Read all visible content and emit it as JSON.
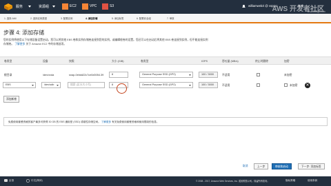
{
  "nav": {
    "services": "服务",
    "resource_groups": "资源组",
    "ec2": "EC2",
    "vpc": "VPC",
    "s3": "S3",
    "account": "williamwebzi @ vopmo",
    "region": "东京"
  },
  "steps": [
    "1. 选择 AMI",
    "2. 选择实例类型",
    "3. 配置实例",
    "4. 添加存储",
    "5. 添加标签",
    "6. 配置安全组",
    "7. 审核"
  ],
  "page": {
    "title": "步骤 4: 添加存储",
    "desc_line1": "您的实例将使用以下存储设备设置启动。您可以将其他 EBS 卷和实例存储卷连接到您的实例，或编辑根卷的设置。您还可以在启动后将其他 EBS 卷连接到实例，但不能连接实例",
    "desc_line2": "存储卷。",
    "desc_link": "了解更多",
    "desc_tail": "关于 Amazon EC2 中的存储选项。"
  },
  "table": {
    "headers": [
      "卷类型",
      "设备",
      "快照",
      "大小 (GiB)",
      "卷类型",
      "IOPS",
      "吞吐量 (MB/s)",
      "终止时删除",
      "加密"
    ],
    "row1": {
      "type": "根目录",
      "device": "/dev/xvda",
      "snapshot": "snap-0ebdd22c7ce0d0054.39",
      "size": "8",
      "volume_type": "General Purpose SSD (GP2)",
      "iops": "100 / 3000",
      "throughput": "不适用",
      "encrypted": "未加密"
    },
    "row2": {
      "type": "EBS",
      "device": "/dev/sdb",
      "snapshot_placeholder": "搜索 (区分大小写)",
      "size": "8",
      "volume_type": "General Purpose SSD (GP2)",
      "iops": "100 / 3000",
      "throughput": "不适用",
      "encrypted": "未加密"
    }
  },
  "add_volume": "添加新卷",
  "notice": {
    "text": "免费使用套餐资格的客户最多可获得 30 GB 的 EBS 通用型 (SSD) 或磁性存储空间。",
    "link": "了解更多",
    "tail": "有关免费使用套餐资格和使用限制的信息。"
  },
  "buttons": {
    "cancel": "取消",
    "previous": "上一步",
    "review_launch": "审核和启动",
    "next": "下一步: 添加标签"
  },
  "footer": {
    "feedback": "反馈",
    "language": "中文(简体)",
    "copyright": "© 2008 - 2017, Amazon Web Services, Inc. 或其附属公司。保留所有权利。",
    "privacy": "隐私策略",
    "terms": "使用条款"
  },
  "watermark": {
    "text": "AWS 开发者社区",
    "url": "www.awsgo.com"
  },
  "colors": {
    "nav_bg": "#232f3e",
    "primary": "#1f6fb5",
    "accent": "#e47911"
  }
}
